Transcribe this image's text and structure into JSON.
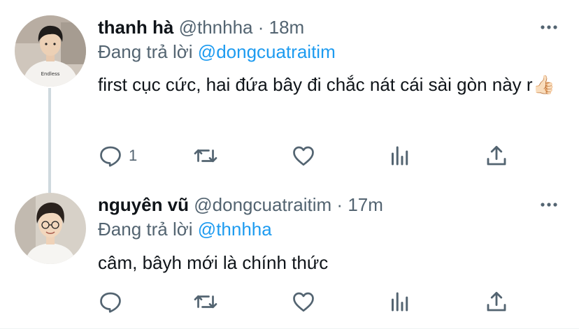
{
  "tweets": [
    {
      "name": "thanh hà",
      "handle": "@thnhha",
      "separator": "·",
      "time": "18m",
      "reply_prefix": "Đang trả lời",
      "reply_to": "@dongcuatraitim",
      "text": "first cục cức, hai đứa bây đi chắc nát cái sài gòn này r👍🏻",
      "reply_count": "1"
    },
    {
      "name": "nguyên vũ",
      "handle": "@dongcuatraitim",
      "separator": "·",
      "time": "17m",
      "reply_prefix": "Đang trả lời",
      "reply_to": "@thnhha",
      "text": "câm, bâyh mới là chính thức",
      "reply_count": ""
    }
  ],
  "icons": {
    "reply": "reply-icon",
    "retweet": "retweet-icon",
    "like": "heart-icon",
    "stats": "analytics-icon",
    "share": "share-icon",
    "more": "more-icon"
  },
  "colors": {
    "mention": "#1d9bf0",
    "secondary_text": "#536471",
    "primary_text": "#0f1419",
    "thread_line": "#cfd9de"
  }
}
